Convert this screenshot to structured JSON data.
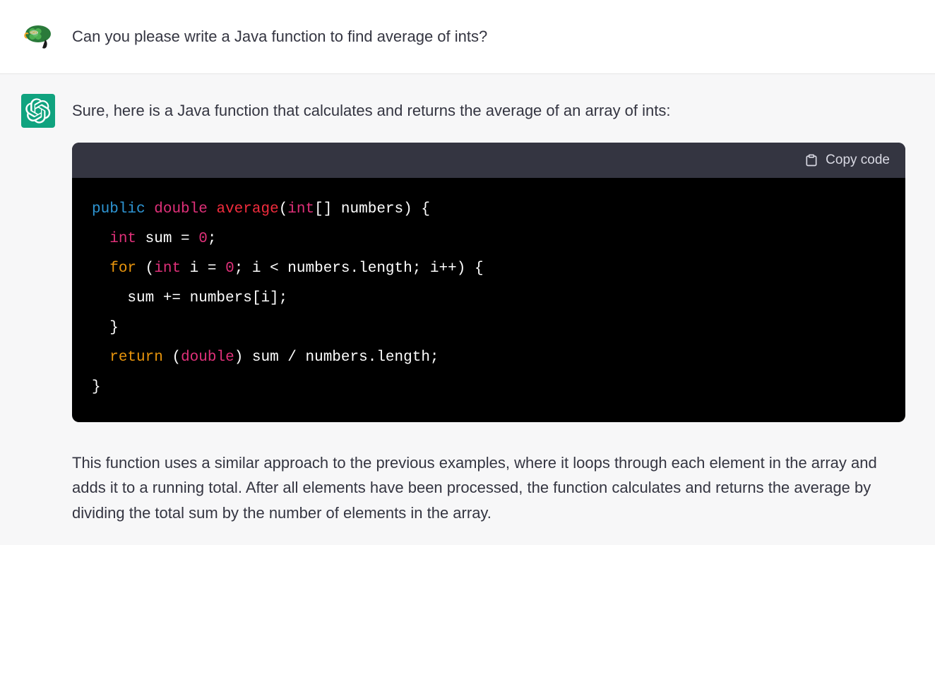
{
  "user": {
    "question": "Can you please write a Java function to find average of ints?"
  },
  "assistant": {
    "intro": "Sure, here is a Java function that calculates and returns the average of an array of ints:",
    "copy_label": "Copy code",
    "explanation": "This function uses a similar approach to the previous examples, where it loops through each element in the array and adds it to a running total. After all elements have been processed, the function calculates and returns the average by dividing the total sum by the number of elements in the array."
  },
  "code": {
    "tokens": {
      "public": "public",
      "double": "double",
      "average": "average",
      "int1": "int",
      "numbers_param": "[] numbers) {",
      "int2": "int",
      "sum_decl": " sum = ",
      "zero1": "0",
      "semi1": ";",
      "for": "for",
      "open_paren": " (",
      "int3": "int",
      "i_decl": " i = ",
      "zero2": "0",
      "loop_cond": "; i < numbers.length; i++) {",
      "sum_add": "    sum += numbers[i];",
      "close_brace1": "  }",
      "return": "return",
      "space1": " (",
      "double2": "double",
      "cast_rest": ") sum / numbers.length;",
      "close_brace2": "}"
    }
  }
}
